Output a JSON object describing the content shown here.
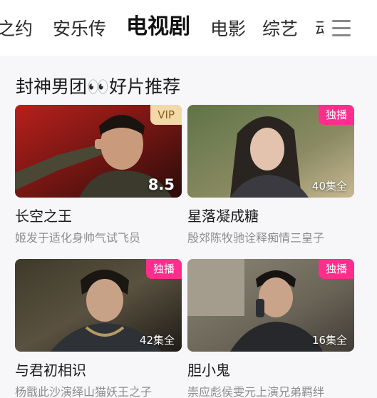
{
  "nav": {
    "tabs": [
      {
        "label": "之约",
        "active": false
      },
      {
        "label": "安乐传",
        "active": false
      },
      {
        "label": "电视剧",
        "active": true
      },
      {
        "label": "电影",
        "active": false
      },
      {
        "label": "综艺",
        "active": false
      },
      {
        "label": "动",
        "active": false
      }
    ],
    "menu_icon": "hamburger-menu-icon"
  },
  "section": {
    "title": "封神男团👀好片推荐"
  },
  "cards": [
    {
      "title": "长空之王",
      "subtitle": "姬发于适化身帅气试飞员",
      "badge": "VIP",
      "badge_type": "vip",
      "corner": "8.5",
      "corner_type": "score"
    },
    {
      "title": "星落凝成糖",
      "subtitle": "殷郊陈牧驰诠释痴情三皇子",
      "badge": "独播",
      "badge_type": "excl",
      "corner": "40集全",
      "corner_type": "episodes"
    },
    {
      "title": "与君初相识",
      "subtitle": "杨戬此沙演绎山猫妖王之子",
      "badge": "独播",
      "badge_type": "excl",
      "corner": "42集全",
      "corner_type": "episodes"
    },
    {
      "title": "胆小鬼",
      "subtitle": "崇应彪侯雯元上演兄弟羁绊",
      "badge": "独播",
      "badge_type": "excl",
      "corner": "16集全",
      "corner_type": "episodes"
    }
  ],
  "colors": {
    "exclusive_badge": "#ff2d8c",
    "vip_badge": "#f2d9a8",
    "section_bg": "#f7f6f9"
  }
}
